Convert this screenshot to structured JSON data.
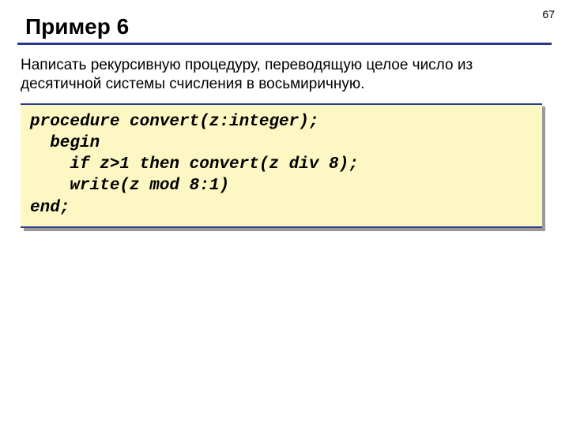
{
  "page_number": "67",
  "title": "Пример 6",
  "description": "Написать рекурсивную процедуру, переводящую целое число из десятичной системы счисления в восьмиричную.",
  "code": {
    "line1": "procedure convert(z:integer);",
    "line2": "  begin",
    "line3": "    if z>1 then convert(z div 8);",
    "line4": "    write(z mod 8:1)",
    "line5": "end;"
  }
}
